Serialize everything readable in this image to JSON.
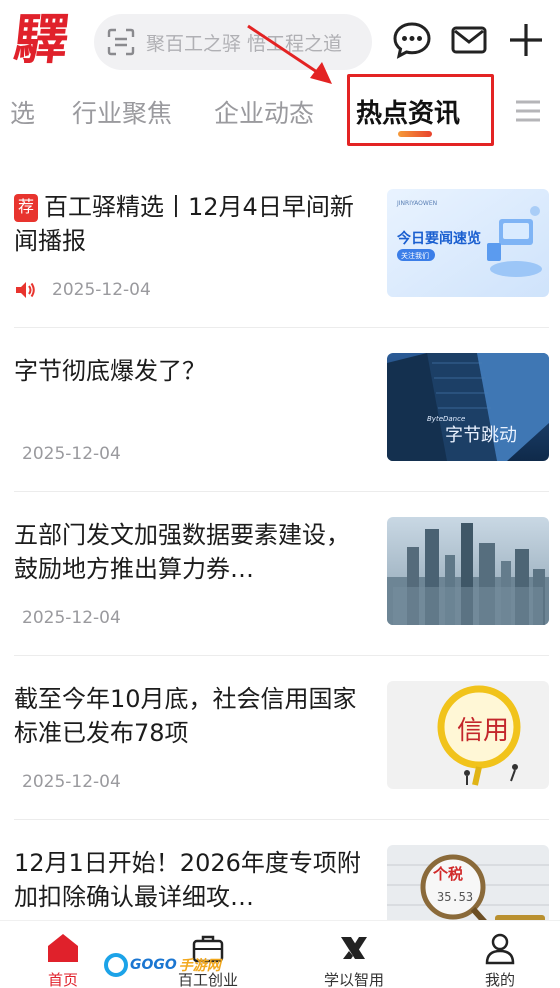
{
  "header": {
    "logo_text": "驛",
    "search_placeholder": "聚百工之驿 悟工程之道",
    "icons": [
      "scan-icon",
      "message-icon",
      "mail-icon",
      "plus-icon"
    ]
  },
  "tabs": {
    "items": [
      {
        "label": "选"
      },
      {
        "label": "行业聚焦"
      },
      {
        "label": "企业动态"
      },
      {
        "label": "热点资讯",
        "active": true
      }
    ],
    "menu_icon": "menu-icon"
  },
  "news": [
    {
      "tag": "荐",
      "title": "百工驿精选丨12月4日早间新闻播报",
      "date": "2025-12-04",
      "has_audio": true,
      "thumb": {
        "main": "今日要闻速览",
        "brand": "JINRIYAOWEN",
        "button": "关注我们"
      }
    },
    {
      "title": "字节彻底爆发了？",
      "date": "2025-12-04",
      "thumb": {
        "sign": "字节跳动",
        "brand": "ByteDance"
      }
    },
    {
      "title": "五部门发文加强数据要素建设，鼓励地方推出算力券…",
      "date": "2025-12-04",
      "thumb": {}
    },
    {
      "title": "截至今年10月底，社会信用国家标准已发布78项",
      "date": "2025-12-04",
      "thumb": {
        "word": "信用"
      }
    },
    {
      "title": "12月1日开始！2026年度专项附加扣除确认最详细攻…",
      "date": "",
      "thumb": {
        "word": "个税",
        "number": "35.53"
      }
    }
  ],
  "bottom_nav": [
    {
      "label": "首页",
      "icon": "home-icon",
      "active": true
    },
    {
      "label": "百工创业",
      "icon": "briefcase-icon"
    },
    {
      "label": "学以智用",
      "icon": "learn-logo-icon"
    },
    {
      "label": "我的",
      "icon": "user-icon"
    }
  ],
  "watermark": {
    "text": "GOGO",
    "text2": "手游网"
  },
  "colors": {
    "brand_red": "#e0212b",
    "tab_underline": "#f0702e",
    "highlight_box": "#e32323"
  }
}
